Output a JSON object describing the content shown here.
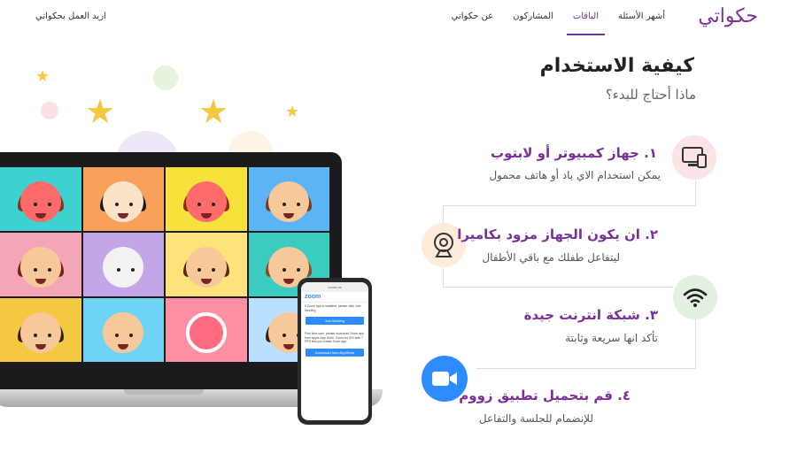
{
  "nav": {
    "logo": "حكواتي",
    "links": [
      {
        "label": "عن حكواتي",
        "active": false
      },
      {
        "label": "المشاركون",
        "active": false
      },
      {
        "label": "الباقات",
        "active": true
      },
      {
        "label": "أشهر الأسئلة",
        "active": false
      }
    ],
    "work_link": "اريد العمل بحكواتي"
  },
  "heading": {
    "title": "كيفية الاستخدام",
    "subtitle": "ماذا أحتاج للبدء؟"
  },
  "steps": [
    {
      "title": "١. جهاز كمبيوتر أو لابتوب",
      "desc": "يمكن استخدام الاي باد أو هاتف محمول",
      "icon": "devices-icon",
      "icon_bg": "#fbe3e6"
    },
    {
      "title": "٢. ان يكون الجهاز مزود بكاميرا",
      "desc": "ليتفاعل طفلك مع باقي الأطفال",
      "icon": "webcam-icon",
      "icon_bg": "#fcecd9"
    },
    {
      "title": "٣. شبكة انترنت جيدة",
      "desc": "تأكد انها سريعة وثابتة",
      "icon": "wifi-icon",
      "icon_bg": "#e3f2e0"
    },
    {
      "title": "٤. قم بتحميل تطبيق زووم",
      "desc": "للإنضمام للجلسة والتفاعل",
      "icon": "zoom-camera-icon",
      "icon_bg": "#2d8cff"
    }
  ],
  "phone": {
    "url": "zoom.us",
    "app_name": "zoom",
    "intro_text": "If Zoom app is installed, please click Join Meeting",
    "join_button": "Join Meeting",
    "download_text": "First time user, please download Zoom app from Apple App Store. Zoom for iOS with 7 FPS lets you create Zoom app",
    "download_button": "Download from AppStore"
  },
  "colors": {
    "accent": "#7b2f9a",
    "zoom_blue": "#2d8cff",
    "star_yellow": "#f5c842"
  }
}
